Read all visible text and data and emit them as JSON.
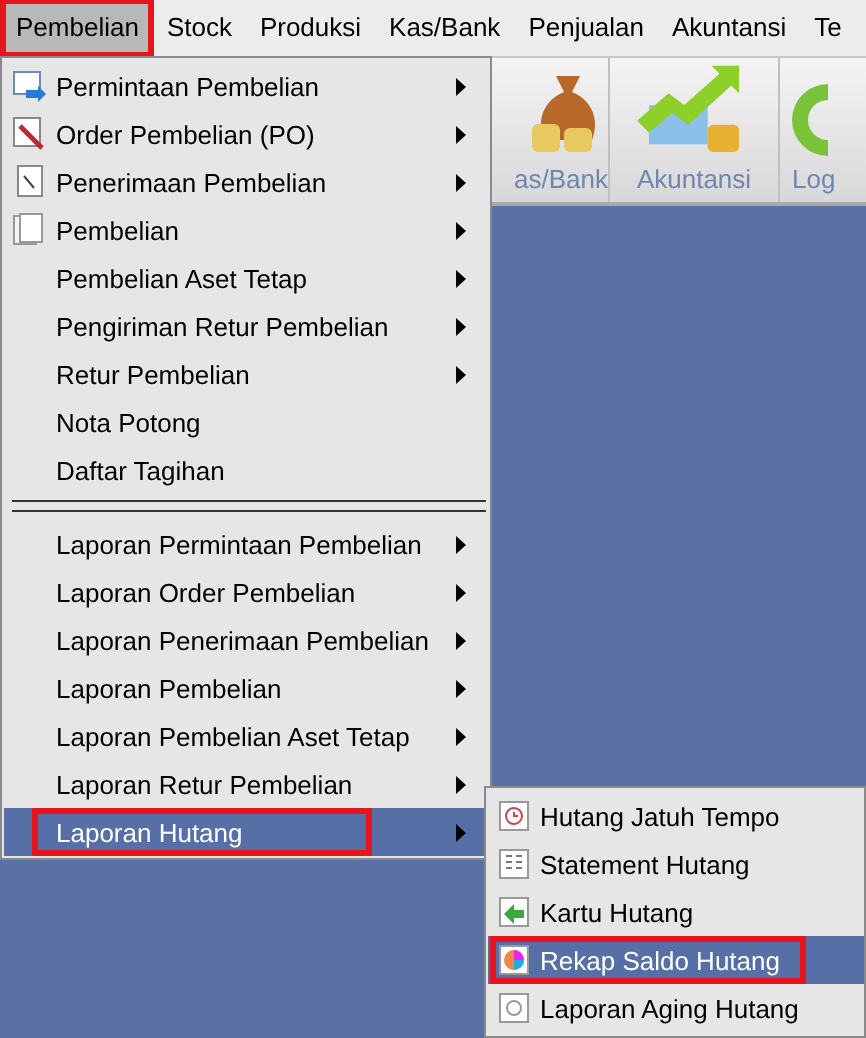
{
  "menu_bar": [
    {
      "label": "Pembelian",
      "selected": true
    },
    {
      "label": "Stock",
      "selected": false
    },
    {
      "label": "Produksi",
      "selected": false
    },
    {
      "label": "Kas/Bank",
      "selected": false
    },
    {
      "label": "Penjualan",
      "selected": false
    },
    {
      "label": "Akuntansi",
      "selected": false
    },
    {
      "label": "Te",
      "selected": false
    }
  ],
  "toolbar": [
    {
      "label": "as/Bank",
      "kind": "money"
    },
    {
      "label": "Akuntansi",
      "kind": "chart"
    },
    {
      "label": "Log",
      "kind": "ring"
    }
  ],
  "menu": {
    "groups": [
      [
        {
          "label": "Permintaan Pembelian",
          "kind": "request",
          "submenu": true,
          "selected": false
        },
        {
          "label": "Order Pembelian (PO)",
          "kind": "order",
          "submenu": true,
          "selected": false
        },
        {
          "label": "Penerimaan Pembelian",
          "kind": "receipt",
          "submenu": true,
          "selected": false
        },
        {
          "label": "Pembelian",
          "kind": "pages",
          "submenu": true,
          "selected": false
        },
        {
          "label": "Pembelian Aset Tetap",
          "kind": "plain",
          "submenu": true,
          "selected": false
        },
        {
          "label": "Pengiriman Retur Pembelian",
          "kind": "plain",
          "submenu": true,
          "selected": false
        },
        {
          "label": "Retur Pembelian",
          "kind": "plain",
          "submenu": true,
          "selected": false
        },
        {
          "label": "Nota Potong",
          "kind": "plain",
          "submenu": false,
          "selected": false
        },
        {
          "label": "Daftar Tagihan",
          "kind": "plain",
          "submenu": false,
          "selected": false
        }
      ],
      [
        {
          "label": "Laporan Permintaan Pembelian",
          "kind": "plain",
          "submenu": true,
          "selected": false
        },
        {
          "label": "Laporan Order Pembelian",
          "kind": "plain",
          "submenu": true,
          "selected": false
        },
        {
          "label": "Laporan Penerimaan Pembelian",
          "kind": "plain",
          "submenu": true,
          "selected": false
        },
        {
          "label": "Laporan Pembelian",
          "kind": "plain",
          "submenu": true,
          "selected": false
        },
        {
          "label": "Laporan Pembelian Aset Tetap",
          "kind": "plain",
          "submenu": true,
          "selected": false
        },
        {
          "label": "Laporan Retur Pembelian",
          "kind": "plain",
          "submenu": true,
          "selected": false
        },
        {
          "label": "Laporan Hutang",
          "kind": "plain",
          "submenu": true,
          "selected": true
        }
      ]
    ]
  },
  "submenu": [
    {
      "label": "Hutang Jatuh Tempo",
      "kind": "clock",
      "selected": false
    },
    {
      "label": "Statement Hutang",
      "kind": "sheet",
      "selected": false
    },
    {
      "label": "Kartu Hutang",
      "kind": "card",
      "selected": false
    },
    {
      "label": "Rekap Saldo Hutang",
      "kind": "pie",
      "selected": true
    },
    {
      "label": "Laporan Aging Hutang",
      "kind": "aging",
      "selected": false
    }
  ]
}
